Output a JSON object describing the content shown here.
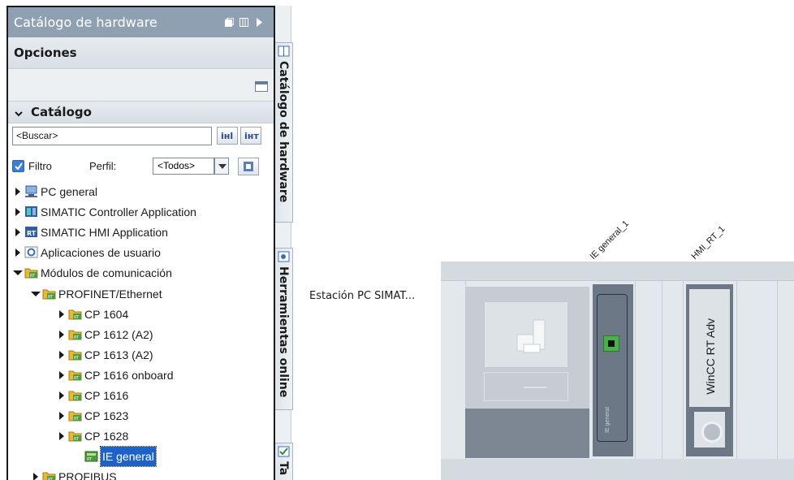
{
  "panel": {
    "title": "Catálogo de hardware",
    "options_header": "Opciones",
    "catalog_header": "Catálogo",
    "search_value": "<Buscar>",
    "filter_label": "Filtro",
    "profile_label": "Perfil:",
    "profile_value": "<Todos>",
    "filter_checked": true
  },
  "tree": [
    {
      "label": "PC general",
      "level": 0,
      "state": "closed",
      "icon": "pc-icon"
    },
    {
      "label": "SIMATIC Controller Application",
      "level": 0,
      "state": "closed",
      "icon": "controller-app-icon"
    },
    {
      "label": "SIMATIC HMI Application",
      "level": 0,
      "state": "closed",
      "icon": "hmi-app-icon"
    },
    {
      "label": "Aplicaciones de usuario",
      "level": 0,
      "state": "closed",
      "icon": "user-app-icon"
    },
    {
      "label": "Módulos de comunicación",
      "level": 0,
      "state": "open",
      "icon": "folder-module-icon"
    },
    {
      "label": "PROFINET/Ethernet",
      "level": 1,
      "state": "open",
      "icon": "folder-module-icon"
    },
    {
      "label": "CP 1604",
      "level": 2,
      "state": "closed",
      "icon": "folder-module-icon"
    },
    {
      "label": "CP 1612 (A2)",
      "level": 2,
      "state": "closed",
      "icon": "folder-module-icon"
    },
    {
      "label": "CP 1613 (A2)",
      "level": 2,
      "state": "closed",
      "icon": "folder-module-icon"
    },
    {
      "label": "CP 1616 onboard",
      "level": 2,
      "state": "closed",
      "icon": "folder-module-icon"
    },
    {
      "label": "CP 1616",
      "level": 2,
      "state": "closed",
      "icon": "folder-module-icon"
    },
    {
      "label": "CP 1623",
      "level": 2,
      "state": "closed",
      "icon": "folder-module-icon"
    },
    {
      "label": "CP 1628",
      "level": 2,
      "state": "closed",
      "icon": "folder-module-icon"
    },
    {
      "label": "IE general",
      "level": 3,
      "state": "leaf",
      "icon": "module-icon",
      "selected": true
    },
    {
      "label": "PROFIBUS",
      "level": 1,
      "state": "closed",
      "icon": "folder-module-icon"
    }
  ],
  "side_tabs": {
    "hardware_catalog": "Catálogo de hardware",
    "online_tools": "Herramientas online",
    "tasks_partial": "Ta"
  },
  "device_view": {
    "station_label": "Estación PC SIMAT...",
    "slot_labels": [
      "IE general_1",
      "HMI_RT_1"
    ],
    "hmi_module_text": "WinCC RT Adv",
    "ie_module_text": "IE general"
  },
  "colors": {
    "title_bar": "#8fa0b2",
    "selection": "#1f62c5",
    "port_green": "#4ab04a",
    "module_dark": "#6d7886",
    "rack_bg": "#e3e8ec"
  }
}
